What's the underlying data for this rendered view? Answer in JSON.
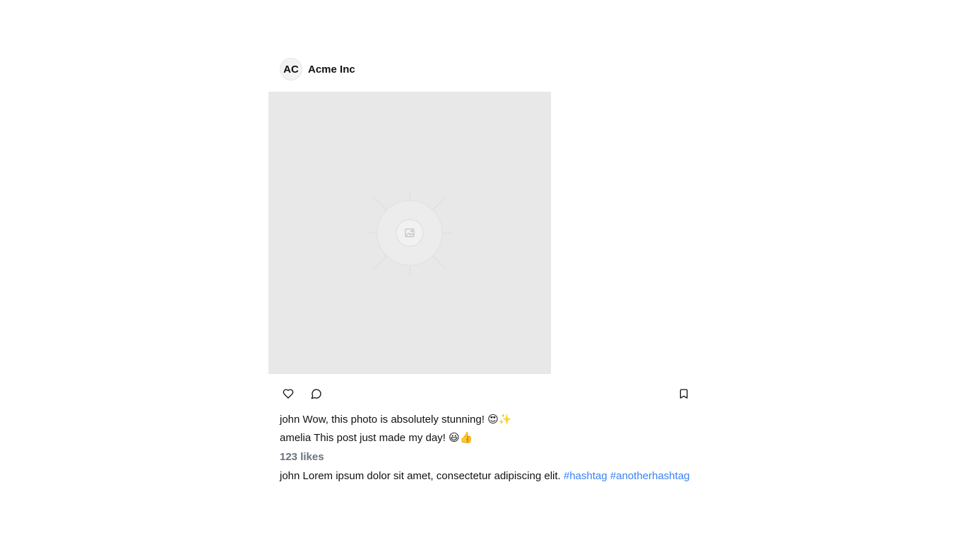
{
  "post": {
    "account": {
      "initials": "AC",
      "name": "Acme Inc"
    },
    "image": {
      "placeholder_icon": "image-placeholder-icon",
      "background": "#e8e8e8"
    },
    "actions": {
      "like_icon": "heart-icon",
      "comment_icon": "comment-bubble-icon",
      "save_icon": "bookmark-icon"
    },
    "comments": [
      {
        "user": "john",
        "text": "Wow, this photo is absolutely stunning! 😍✨"
      },
      {
        "user": "amelia",
        "text": "This post just made my day! 😃👍"
      }
    ],
    "likes": "123 likes",
    "caption": {
      "user": "john",
      "text": "Lorem ipsum dolor sit amet, consectetur adipiscing elit.",
      "hashtags": [
        "#hashtag",
        "#anotherhashtag"
      ]
    }
  },
  "colors": {
    "hashtag": "#3b82f6",
    "likes": "#6b7280",
    "text": "#111111"
  }
}
